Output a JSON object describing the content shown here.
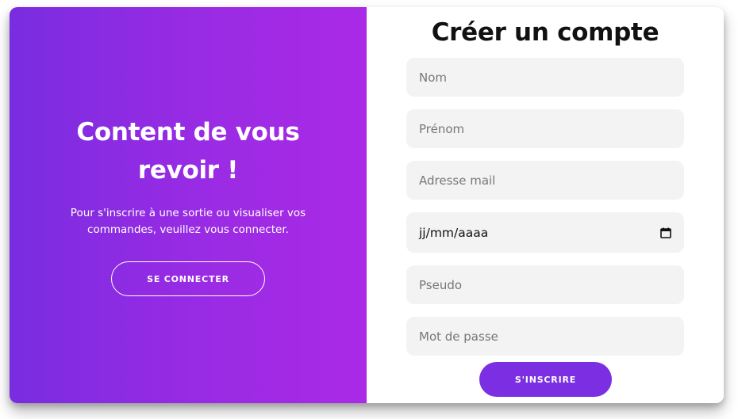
{
  "left_panel": {
    "title_line1": "Content de vous",
    "title_line2": "revoir !",
    "text_line1": "Pour s'inscrire à une sortie ou visualiser vos",
    "text_line2": "commandes, veuillez vous connecter.",
    "connect_button": "SE CONNECTER"
  },
  "signup_form": {
    "title": "Créer un compte",
    "fields": {
      "last_name_placeholder": "Nom",
      "first_name_placeholder": "Prénom",
      "email_placeholder": "Adresse mail",
      "birthdate_value": "jj/mm/aaaa",
      "username_placeholder": "Pseudo",
      "password_placeholder": "Mot de passe"
    },
    "submit_button": "S'INSCRIRE"
  },
  "colors": {
    "gradient_start": "#7a2ce0",
    "gradient_end": "#aa2ae6",
    "accent": "#7b2ee2",
    "field_background": "#f3f3f3"
  },
  "icons": {
    "date_picker": "calendar-icon"
  }
}
